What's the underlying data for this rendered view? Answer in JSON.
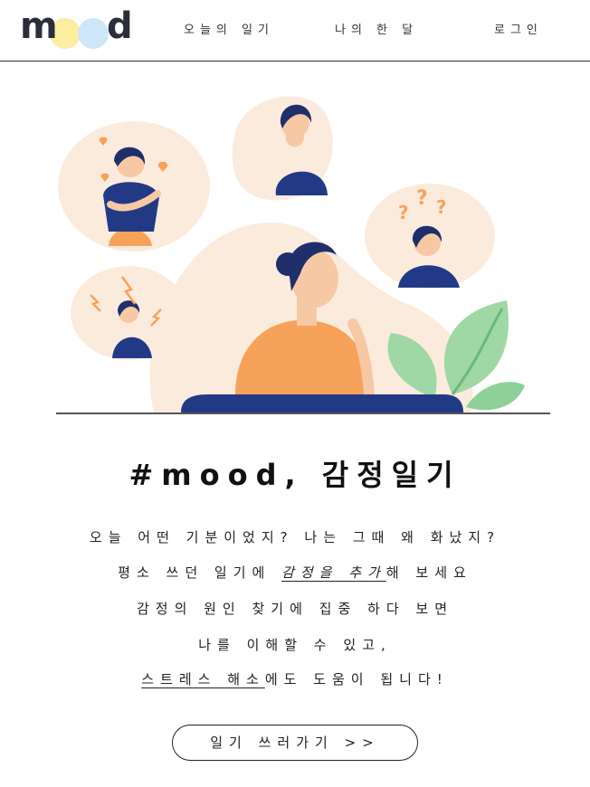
{
  "logo": {
    "text_start": "m",
    "text_end": "d",
    "o1_color": "#FCEEA0",
    "o2_color": "#CFE6F8"
  },
  "nav": [
    {
      "label": "오늘의 일기"
    },
    {
      "label": "나의 한 달"
    },
    {
      "label": "로그인"
    }
  ],
  "hero": {
    "title": "#mood, 감정일기",
    "line1": "오늘 어떤 기분이었지? 나는 그때 왜 화났지?",
    "line2_pre": "평소 쓰던 일기에 ",
    "line2_link": "감정을 추가",
    "line2_post": "해 보세요",
    "line3": "감정의 원인 찾기에 집중 하다 보면",
    "line4": "나를 이해할 수 있고,",
    "line5_link": "스트레스 해소",
    "line5_post": "에도 도움이 됩니다!",
    "cta_label": "일기 쓰러가기 >>"
  },
  "colors": {
    "blob": "#FBEBDD",
    "shirt": "#F7A25A",
    "navy": "#223A86",
    "hair": "#1E2F6B",
    "leaf": "#7EC98C",
    "skin": "#F6C9A4"
  },
  "illustration": {
    "icons": [
      "heart-icon",
      "question-icon",
      "lightning-icon",
      "leaf-icon"
    ]
  }
}
